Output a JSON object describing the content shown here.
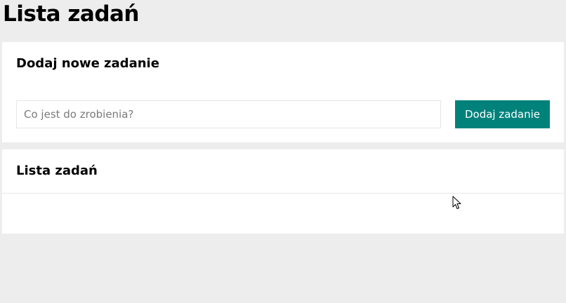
{
  "page": {
    "title": "Lista zadań"
  },
  "add_section": {
    "heading": "Dodaj nowe zadanie",
    "input_value": "",
    "input_placeholder": "Co jest do zrobienia?",
    "button_label": "Dodaj zadanie"
  },
  "list_section": {
    "heading": "Lista zadań",
    "items": []
  },
  "colors": {
    "background": "#ededed",
    "card": "#ffffff",
    "accent": "#00827b"
  },
  "icons": {
    "cursor": "mouse-pointer-icon"
  }
}
